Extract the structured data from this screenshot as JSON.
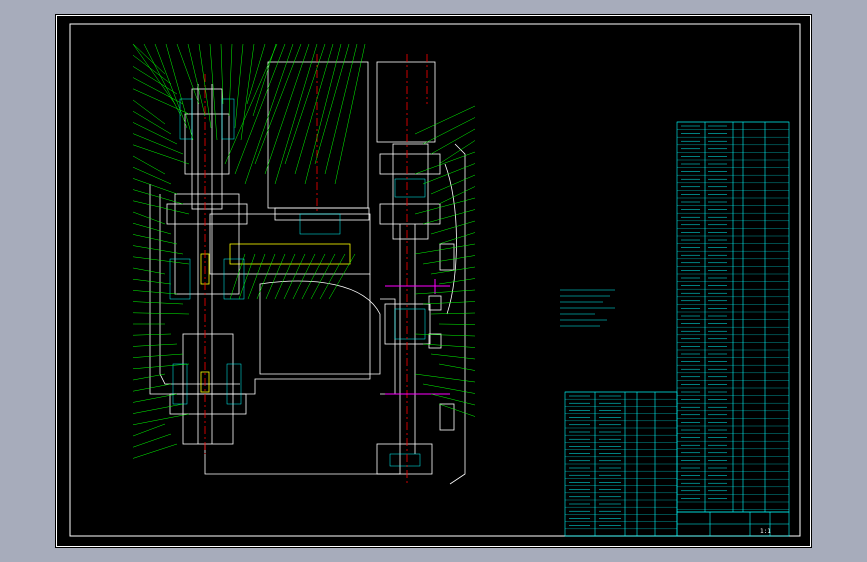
{
  "colors": {
    "background": "#000000",
    "frame": "#ffffff",
    "geometry": "#ffffff",
    "leaders": "#00ff00",
    "notes": "#00ffff",
    "table": "#00ffff",
    "centerline": "#ff0000",
    "section_marker": "#ff00ff"
  },
  "notes_block": {
    "lines": [
      "",
      "",
      "",
      "",
      "",
      "",
      "",
      ""
    ]
  },
  "title_block": {
    "drawing_title": "",
    "scale": "1:1"
  }
}
